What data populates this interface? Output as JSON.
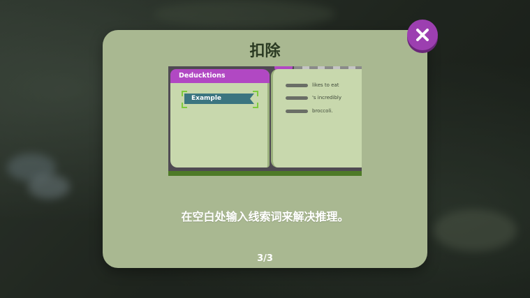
{
  "dialog": {
    "title": "扣除",
    "instruction": "在空白处输入线索词来解决推理。",
    "page_indicator": "3/3"
  },
  "illustration": {
    "tab_label": "Deducktions",
    "example_label": "Example",
    "clues": [
      "likes to eat",
      "'s incredibly",
      "broccoli."
    ]
  },
  "icons": {
    "close": "close-x-icon"
  },
  "colors": {
    "panel": "#a9b891",
    "title": "#2a3a22",
    "close_button": "#9c3fb0",
    "tab": "#b148c3",
    "example_tag": "#3b7580",
    "page": "#c8d8ad"
  }
}
